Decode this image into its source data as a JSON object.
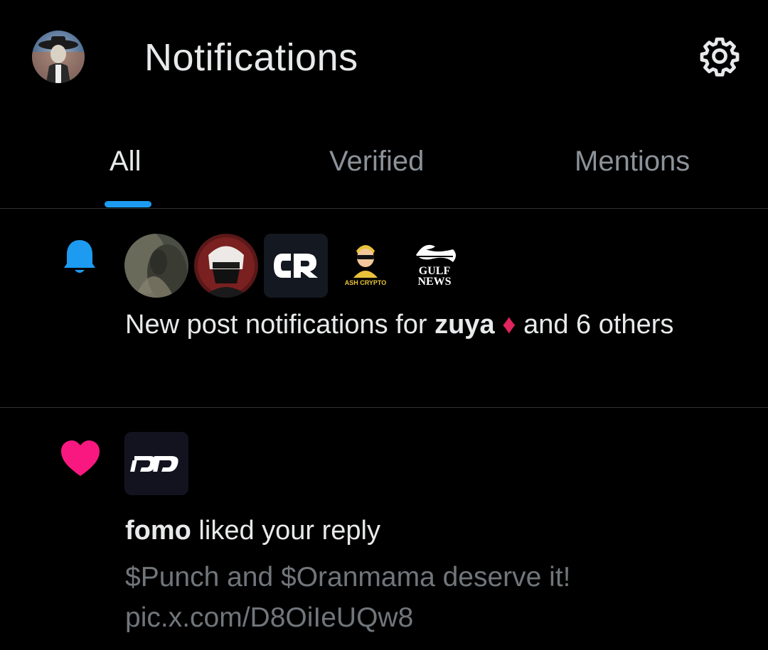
{
  "header": {
    "title": "Notifications",
    "profile_avatar_icon": "profile-avatar",
    "settings_icon": "gear-icon"
  },
  "tabs": [
    {
      "label": "All",
      "active": true
    },
    {
      "label": "Verified",
      "active": false
    },
    {
      "label": "Mentions",
      "active": false
    }
  ],
  "colors": {
    "background": "#000000",
    "accent": "#1d9bf0",
    "text_primary": "#e7e9ea",
    "text_secondary": "#71767b",
    "bell": "#1d9bf0",
    "heart": "#f91880",
    "divider": "#2f3336"
  },
  "notifications": [
    {
      "type": "new-post",
      "icon": "bell-icon",
      "avatars": [
        "zuya-avatar",
        "ninja-avatar",
        "cr-logo-avatar",
        "ash-crypto-avatar",
        "gulf-news-avatar"
      ],
      "avatar_labels": {
        "ash_crypto": "ASH CRYPTO",
        "gulf_news_line1": "GULF",
        "gulf_news_line2": "NEWS"
      },
      "text_prefix": "New post notifications for ",
      "user": "zuya",
      "emoji": "♦",
      "text_suffix": " and 6 others"
    },
    {
      "type": "like",
      "icon": "heart-icon",
      "avatar": "fomo-logo-avatar",
      "user": "fomo",
      "action": " liked your reply",
      "reply_text": "$Punch and $Oranmama deserve it! pic.x.com/D8OiIeUQw8"
    }
  ]
}
